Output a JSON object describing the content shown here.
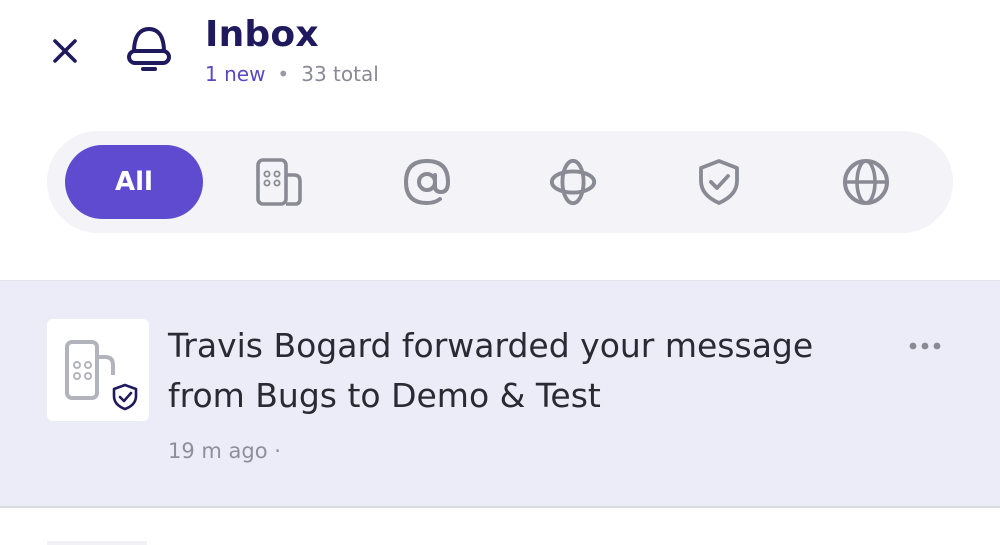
{
  "header": {
    "title": "Inbox",
    "new_count": "1 new",
    "separator": "•",
    "total_count": "33 total",
    "close_icon": "close-icon",
    "bell_icon": "bell-icon"
  },
  "filters": {
    "selected_label": "All",
    "items": [
      {
        "label": "All",
        "icon": "none",
        "selected": true
      },
      {
        "icon": "apps-icon",
        "selected": false
      },
      {
        "icon": "at-icon",
        "selected": false
      },
      {
        "icon": "orbit-icon",
        "selected": false
      },
      {
        "icon": "shield-check-icon",
        "selected": false
      },
      {
        "icon": "globe-icon",
        "selected": false
      }
    ]
  },
  "notifications": [
    {
      "text": "Travis Bogard forwarded your message from Bugs to  Demo & Test",
      "time": "19 m ago ·",
      "unread": true,
      "avatar_icon": "apps-icon",
      "badge_icon": "shield-check-icon",
      "more_icon": "more-horizontal-icon"
    }
  ],
  "colors": {
    "accent": "#5e4bd0",
    "title": "#1f1a5e",
    "unread_bg": "#ecebf8",
    "filter_bg": "#f3f3f8"
  }
}
